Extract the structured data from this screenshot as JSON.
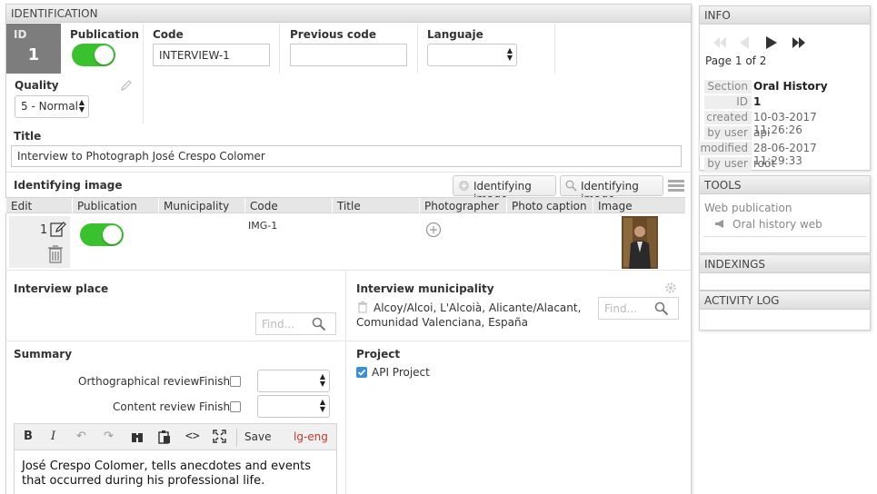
{
  "identification": {
    "header": "IDENTIFICATION",
    "id_label": "ID",
    "id_value": "1",
    "publication_label": "Publication",
    "code_label": "Code",
    "code_value": "INTERVIEW-1",
    "previous_code_label": "Previous code",
    "previous_code_value": "",
    "language_label": "Languaje",
    "language_value": "",
    "quality_label": "Quality",
    "quality_value": "5 - Normal",
    "title_label": "Title",
    "title_value": "Interview to Photograph  José Crespo Colomer"
  },
  "identifying_image": {
    "label": "Identifying image",
    "button_add": "Identifying image",
    "button_search": "Identifying image",
    "columns": [
      "Edit",
      "Publication",
      "Municipality",
      "Code",
      "Title",
      "Photographer",
      "Photo caption",
      "Image"
    ],
    "rows": [
      {
        "edit_number": "1",
        "code": "IMG-1"
      }
    ]
  },
  "interview_place": {
    "label": "Interview place",
    "find_placeholder": "Find..."
  },
  "interview_municipality": {
    "label": "Interview municipality",
    "value": "Alcoy/Alcoi, L'Alcoià, Alicante/Alacant, Comunidad Valenciana, España",
    "find_placeholder": "Find..."
  },
  "summary": {
    "label": "Summary",
    "orthographical_review_label": "Orthographical review",
    "content_review_label": "Content review",
    "finish_label": "Finish",
    "toolbar": {
      "bold": "B",
      "italic": "I",
      "save": "Save",
      "lang": "lg-eng"
    },
    "text": "José Crespo Colomer, tells anecdotes and events that occurred during his professional life."
  },
  "project": {
    "label": "Project",
    "item": "API Project"
  },
  "info": {
    "header": "INFO",
    "page_text": "Page 1 of 2",
    "rows": [
      {
        "key": "Section",
        "value": "Oral History"
      },
      {
        "key": "ID",
        "value": "1"
      },
      {
        "key": "created",
        "value": "10-03-2017 11:26:26"
      },
      {
        "key": "by user",
        "value": "api"
      },
      {
        "key": "modified",
        "value": "28-06-2017 11:29:33"
      },
      {
        "key": "by user",
        "value": "root"
      }
    ]
  },
  "tools": {
    "header": "TOOLS",
    "web_publication": "Web publication",
    "oral_history_web": "Oral history web"
  },
  "indexings": {
    "header": "INDEXINGS"
  },
  "activity_log": {
    "header": "ACTIVITY LOG"
  },
  "colors": {
    "toggle_on": "#39c12e",
    "accent_red": "#c0392b",
    "link_blue": "#3b8fd6"
  }
}
